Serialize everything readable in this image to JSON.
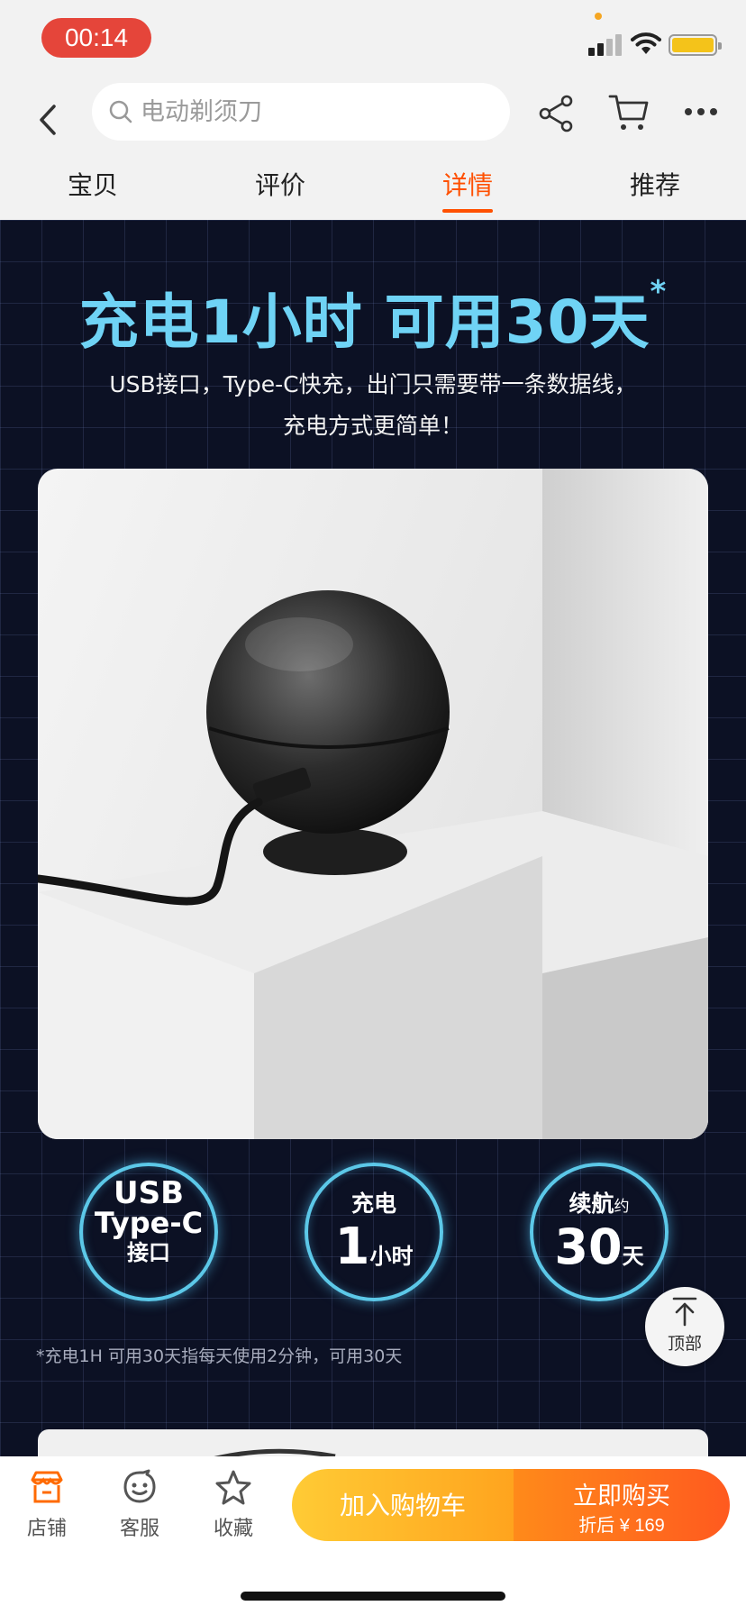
{
  "status_bar": {
    "time": "00:14"
  },
  "nav": {
    "search_placeholder": "电动剃须刀"
  },
  "tabs": [
    {
      "label": "宝贝"
    },
    {
      "label": "评价"
    },
    {
      "label": "详情",
      "active": true
    },
    {
      "label": "推荐"
    }
  ],
  "detail": {
    "headline": "充电1小时  可用30天",
    "headline_mark": "*",
    "desc_line1": "USB接口，Type-C快充，出门只需要带一条数据线，",
    "desc_line2": "充电方式更简单！",
    "badges": [
      {
        "line1": "USB",
        "line2": "Type-C",
        "line3": "接口"
      },
      {
        "line1": "充电",
        "big": "1",
        "unit": "小时"
      },
      {
        "line1": "续航",
        "line1_small": "约",
        "big": "30",
        "unit": "天"
      }
    ],
    "footnote": "*充电1H 可用30天指每天使用2分钟，可用30天"
  },
  "back_to_top": {
    "label": "顶部"
  },
  "bottom_bar": {
    "store": "店铺",
    "service": "客服",
    "favorite": "收藏",
    "add_to_cart": "加入购物车",
    "buy_now": "立即购买",
    "discount_price": "折后 ¥ 169"
  },
  "colors": {
    "accent": "#ff5000",
    "headline": "#6fd3f5",
    "time_pill": "#e5453a"
  }
}
